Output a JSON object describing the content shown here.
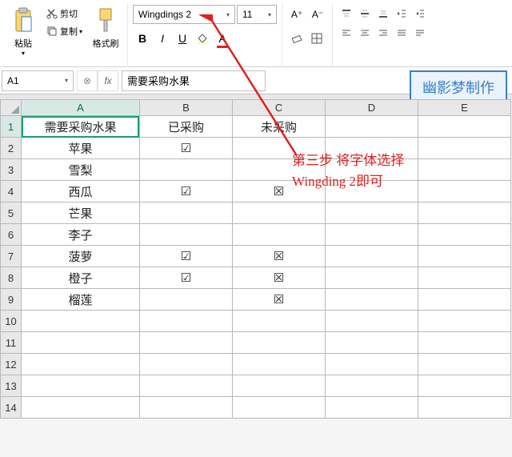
{
  "ribbon": {
    "paste_label": "粘贴",
    "cut_label": "剪切",
    "copy_label": "复制",
    "format_painter_label": "格式刷",
    "font_name": "Wingdings 2",
    "font_size": "11",
    "bold": "B",
    "italic": "I",
    "underline": "U",
    "fill_color_icon": "fill",
    "font_color_letter": "A",
    "grow_font": "A⁺",
    "shrink_font": "A⁻"
  },
  "formula_bar": {
    "name_box": "A1",
    "fx_label": "fx",
    "formula_value": "需要采购水果"
  },
  "badge": "幽影梦制作",
  "columns": [
    "A",
    "B",
    "C",
    "D",
    "E"
  ],
  "rows": [
    {
      "n": 1,
      "A": "需要采购水果",
      "B": "已采购",
      "C": "未采购",
      "D": "",
      "E": ""
    },
    {
      "n": 2,
      "A": "苹果",
      "B": "☑",
      "C": "",
      "D": "",
      "E": ""
    },
    {
      "n": 3,
      "A": "雪梨",
      "B": "",
      "C": "",
      "D": "",
      "E": ""
    },
    {
      "n": 4,
      "A": "西瓜",
      "B": "☑",
      "C": "☒",
      "D": "",
      "E": ""
    },
    {
      "n": 5,
      "A": "芒果",
      "B": "",
      "C": "",
      "D": "",
      "E": ""
    },
    {
      "n": 6,
      "A": "李子",
      "B": "",
      "C": "",
      "D": "",
      "E": ""
    },
    {
      "n": 7,
      "A": "菠萝",
      "B": "☑",
      "C": "☒",
      "D": "",
      "E": ""
    },
    {
      "n": 8,
      "A": "橙子",
      "B": "☑",
      "C": "☒",
      "D": "",
      "E": ""
    },
    {
      "n": 9,
      "A": "榴莲",
      "B": "",
      "C": "☒",
      "D": "",
      "E": ""
    },
    {
      "n": 10,
      "A": "",
      "B": "",
      "C": "",
      "D": "",
      "E": ""
    },
    {
      "n": 11,
      "A": "",
      "B": "",
      "C": "",
      "D": "",
      "E": ""
    },
    {
      "n": 12,
      "A": "",
      "B": "",
      "C": "",
      "D": "",
      "E": ""
    },
    {
      "n": 13,
      "A": "",
      "B": "",
      "C": "",
      "D": "",
      "E": ""
    },
    {
      "n": 14,
      "A": "",
      "B": "",
      "C": "",
      "D": "",
      "E": ""
    }
  ],
  "annotation": {
    "line1": "第三步 将字体选择",
    "line2": "Wingding 2即可"
  }
}
